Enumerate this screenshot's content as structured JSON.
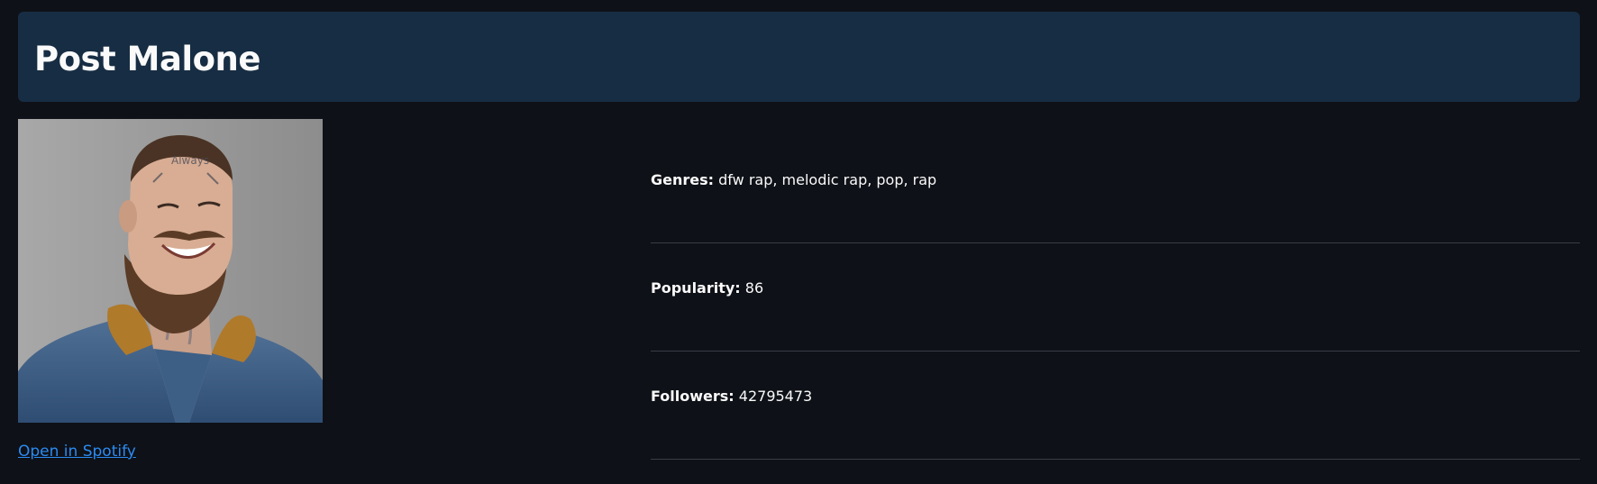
{
  "header": {
    "title": "Post Malone"
  },
  "artist": {
    "image_alt": "Post Malone",
    "spotify_link_label": "Open in Spotify"
  },
  "info": [
    {
      "label": "Genres:",
      "value": "dfw rap, melodic rap, pop, rap"
    },
    {
      "label": "Popularity:",
      "value": "86"
    },
    {
      "label": "Followers:",
      "value": "42795473"
    }
  ],
  "colors": {
    "background": "#0e1117",
    "header_background": "#172d43",
    "link": "#2b8bf3",
    "divider": "#3a3d45"
  }
}
